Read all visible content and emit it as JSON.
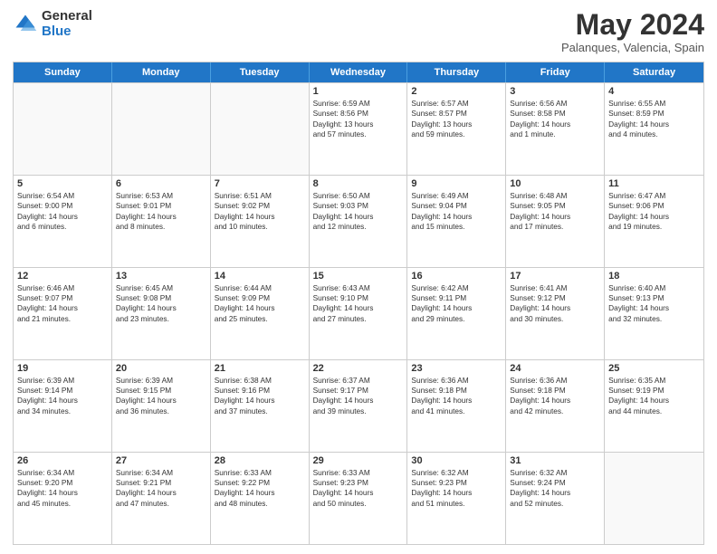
{
  "logo": {
    "general": "General",
    "blue": "Blue"
  },
  "header": {
    "title": "May 2024",
    "subtitle": "Palanques, Valencia, Spain"
  },
  "calendar": {
    "days": [
      "Sunday",
      "Monday",
      "Tuesday",
      "Wednesday",
      "Thursday",
      "Friday",
      "Saturday"
    ],
    "rows": [
      [
        {
          "day": "",
          "lines": []
        },
        {
          "day": "",
          "lines": []
        },
        {
          "day": "",
          "lines": []
        },
        {
          "day": "1",
          "lines": [
            "Sunrise: 6:59 AM",
            "Sunset: 8:56 PM",
            "Daylight: 13 hours",
            "and 57 minutes."
          ]
        },
        {
          "day": "2",
          "lines": [
            "Sunrise: 6:57 AM",
            "Sunset: 8:57 PM",
            "Daylight: 13 hours",
            "and 59 minutes."
          ]
        },
        {
          "day": "3",
          "lines": [
            "Sunrise: 6:56 AM",
            "Sunset: 8:58 PM",
            "Daylight: 14 hours",
            "and 1 minute."
          ]
        },
        {
          "day": "4",
          "lines": [
            "Sunrise: 6:55 AM",
            "Sunset: 8:59 PM",
            "Daylight: 14 hours",
            "and 4 minutes."
          ]
        }
      ],
      [
        {
          "day": "5",
          "lines": [
            "Sunrise: 6:54 AM",
            "Sunset: 9:00 PM",
            "Daylight: 14 hours",
            "and 6 minutes."
          ]
        },
        {
          "day": "6",
          "lines": [
            "Sunrise: 6:53 AM",
            "Sunset: 9:01 PM",
            "Daylight: 14 hours",
            "and 8 minutes."
          ]
        },
        {
          "day": "7",
          "lines": [
            "Sunrise: 6:51 AM",
            "Sunset: 9:02 PM",
            "Daylight: 14 hours",
            "and 10 minutes."
          ]
        },
        {
          "day": "8",
          "lines": [
            "Sunrise: 6:50 AM",
            "Sunset: 9:03 PM",
            "Daylight: 14 hours",
            "and 12 minutes."
          ]
        },
        {
          "day": "9",
          "lines": [
            "Sunrise: 6:49 AM",
            "Sunset: 9:04 PM",
            "Daylight: 14 hours",
            "and 15 minutes."
          ]
        },
        {
          "day": "10",
          "lines": [
            "Sunrise: 6:48 AM",
            "Sunset: 9:05 PM",
            "Daylight: 14 hours",
            "and 17 minutes."
          ]
        },
        {
          "day": "11",
          "lines": [
            "Sunrise: 6:47 AM",
            "Sunset: 9:06 PM",
            "Daylight: 14 hours",
            "and 19 minutes."
          ]
        }
      ],
      [
        {
          "day": "12",
          "lines": [
            "Sunrise: 6:46 AM",
            "Sunset: 9:07 PM",
            "Daylight: 14 hours",
            "and 21 minutes."
          ]
        },
        {
          "day": "13",
          "lines": [
            "Sunrise: 6:45 AM",
            "Sunset: 9:08 PM",
            "Daylight: 14 hours",
            "and 23 minutes."
          ]
        },
        {
          "day": "14",
          "lines": [
            "Sunrise: 6:44 AM",
            "Sunset: 9:09 PM",
            "Daylight: 14 hours",
            "and 25 minutes."
          ]
        },
        {
          "day": "15",
          "lines": [
            "Sunrise: 6:43 AM",
            "Sunset: 9:10 PM",
            "Daylight: 14 hours",
            "and 27 minutes."
          ]
        },
        {
          "day": "16",
          "lines": [
            "Sunrise: 6:42 AM",
            "Sunset: 9:11 PM",
            "Daylight: 14 hours",
            "and 29 minutes."
          ]
        },
        {
          "day": "17",
          "lines": [
            "Sunrise: 6:41 AM",
            "Sunset: 9:12 PM",
            "Daylight: 14 hours",
            "and 30 minutes."
          ]
        },
        {
          "day": "18",
          "lines": [
            "Sunrise: 6:40 AM",
            "Sunset: 9:13 PM",
            "Daylight: 14 hours",
            "and 32 minutes."
          ]
        }
      ],
      [
        {
          "day": "19",
          "lines": [
            "Sunrise: 6:39 AM",
            "Sunset: 9:14 PM",
            "Daylight: 14 hours",
            "and 34 minutes."
          ]
        },
        {
          "day": "20",
          "lines": [
            "Sunrise: 6:39 AM",
            "Sunset: 9:15 PM",
            "Daylight: 14 hours",
            "and 36 minutes."
          ]
        },
        {
          "day": "21",
          "lines": [
            "Sunrise: 6:38 AM",
            "Sunset: 9:16 PM",
            "Daylight: 14 hours",
            "and 37 minutes."
          ]
        },
        {
          "day": "22",
          "lines": [
            "Sunrise: 6:37 AM",
            "Sunset: 9:17 PM",
            "Daylight: 14 hours",
            "and 39 minutes."
          ]
        },
        {
          "day": "23",
          "lines": [
            "Sunrise: 6:36 AM",
            "Sunset: 9:18 PM",
            "Daylight: 14 hours",
            "and 41 minutes."
          ]
        },
        {
          "day": "24",
          "lines": [
            "Sunrise: 6:36 AM",
            "Sunset: 9:18 PM",
            "Daylight: 14 hours",
            "and 42 minutes."
          ]
        },
        {
          "day": "25",
          "lines": [
            "Sunrise: 6:35 AM",
            "Sunset: 9:19 PM",
            "Daylight: 14 hours",
            "and 44 minutes."
          ]
        }
      ],
      [
        {
          "day": "26",
          "lines": [
            "Sunrise: 6:34 AM",
            "Sunset: 9:20 PM",
            "Daylight: 14 hours",
            "and 45 minutes."
          ]
        },
        {
          "day": "27",
          "lines": [
            "Sunrise: 6:34 AM",
            "Sunset: 9:21 PM",
            "Daylight: 14 hours",
            "and 47 minutes."
          ]
        },
        {
          "day": "28",
          "lines": [
            "Sunrise: 6:33 AM",
            "Sunset: 9:22 PM",
            "Daylight: 14 hours",
            "and 48 minutes."
          ]
        },
        {
          "day": "29",
          "lines": [
            "Sunrise: 6:33 AM",
            "Sunset: 9:23 PM",
            "Daylight: 14 hours",
            "and 50 minutes."
          ]
        },
        {
          "day": "30",
          "lines": [
            "Sunrise: 6:32 AM",
            "Sunset: 9:23 PM",
            "Daylight: 14 hours",
            "and 51 minutes."
          ]
        },
        {
          "day": "31",
          "lines": [
            "Sunrise: 6:32 AM",
            "Sunset: 9:24 PM",
            "Daylight: 14 hours",
            "and 52 minutes."
          ]
        },
        {
          "day": "",
          "lines": []
        }
      ]
    ]
  }
}
